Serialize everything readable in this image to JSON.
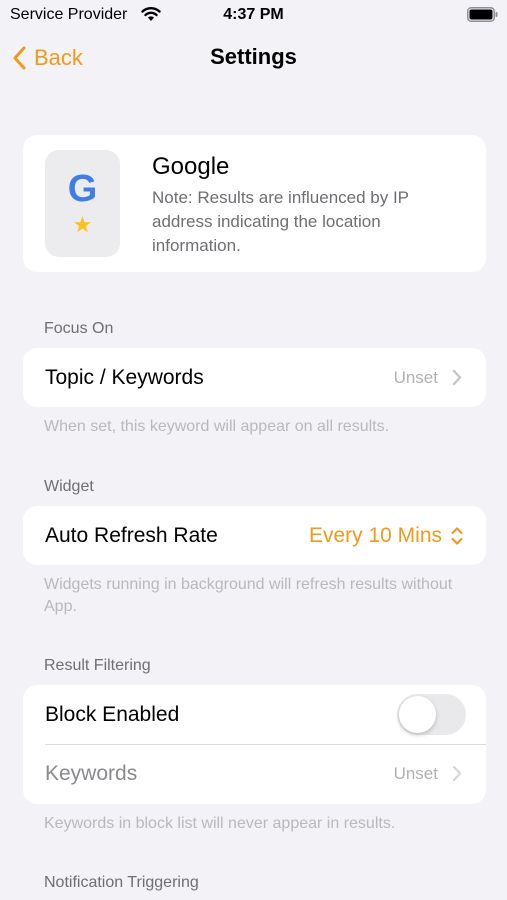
{
  "status_bar": {
    "carrier": "Service Provider",
    "time": "4:37 PM"
  },
  "nav": {
    "back_label": "Back",
    "title": "Settings"
  },
  "engine": {
    "icon_letter": "G",
    "icon_badge": "★",
    "name": "Google",
    "note": "Note: Results are influenced by IP address indicating the location information."
  },
  "focus_on": {
    "header": "Focus On",
    "topic_label": "Topic / Keywords",
    "topic_value": "Unset",
    "footer": "When set, this keyword will appear on all results."
  },
  "widget": {
    "header": "Widget",
    "refresh_label": "Auto Refresh Rate",
    "refresh_value": "Every 10 Mins",
    "footer": "Widgets running in background will refresh results without App."
  },
  "result_filtering": {
    "header": "Result Filtering",
    "block_label": "Block Enabled",
    "block_enabled": false,
    "keywords_label": "Keywords",
    "keywords_value": "Unset",
    "footer": "Keywords in block list will never appear in results."
  },
  "notification": {
    "header": "Notification Triggering"
  },
  "colors": {
    "accent": "#f09a1a",
    "google_blue": "#3f7ee8",
    "star": "#f7c21a",
    "background": "#f2f2f7"
  }
}
